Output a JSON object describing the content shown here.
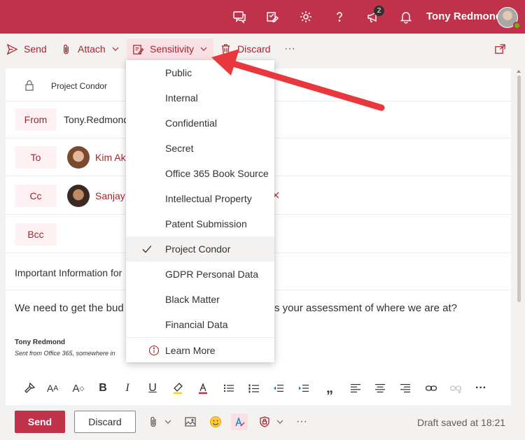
{
  "topbar": {
    "user_name": "Tony Redmond",
    "notification_count": "2",
    "icons": [
      "chat-icon",
      "tasks-icon",
      "gear-icon",
      "help-icon",
      "megaphone-icon",
      "bell-icon"
    ]
  },
  "toolbar": {
    "send_label": "Send",
    "attach_label": "Attach",
    "sensitivity_label": "Sensitivity",
    "discard_label": "Discard",
    "more_label": "···"
  },
  "compose": {
    "sensitivity_banner": "Project Condor",
    "from_label": "From",
    "from_value": "Tony.Redmond",
    "to_label": "To",
    "to_recipient": "Kim Ak",
    "cc_label": "Cc",
    "cc_recipient": "Sanjay",
    "bcc_label": "Bcc",
    "subject": "Important Information for",
    "body_start": "We need to get the bud",
    "body_end": "s your assessment of where we are at?",
    "signature_name": "Tony Redmond",
    "signature_line": "Sent from Office 365, somewhere in"
  },
  "sensitivity_menu": {
    "items": [
      {
        "label": "Public"
      },
      {
        "label": "Internal"
      },
      {
        "label": "Confidential"
      },
      {
        "label": "Secret"
      },
      {
        "label": "Office 365 Book Source"
      },
      {
        "label": "Intellectual Property"
      },
      {
        "label": "Patent Submission"
      },
      {
        "label": "Project Condor",
        "selected": true
      },
      {
        "label": "GDPR Personal Data"
      },
      {
        "label": "Black Matter"
      },
      {
        "label": "Financial Data"
      }
    ],
    "learn_more": "Learn More"
  },
  "bottom": {
    "send_label": "Send",
    "discard_label": "Discard",
    "more_label": "···",
    "draft_status": "Draft saved at 18:21"
  },
  "colors": {
    "brand": "#c0314a",
    "accent_text": "#a4262c",
    "annotation_arrow": "#e8383d"
  }
}
